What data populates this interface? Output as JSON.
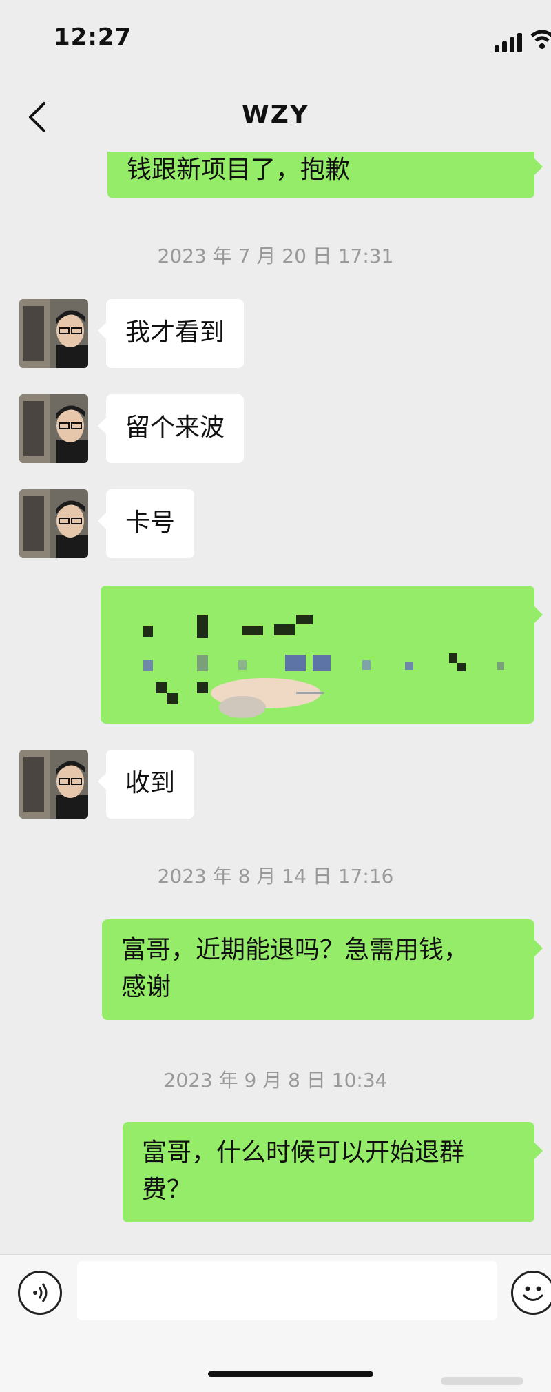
{
  "status_bar": {
    "time": "12:27",
    "icons": [
      "signal-icon",
      "wifi-icon"
    ]
  },
  "nav": {
    "title": "WZY",
    "back_icon": "chevron-left-icon"
  },
  "messages": [
    {
      "type": "text",
      "side": "out",
      "text": "钱跟新项目了，抱歉"
    },
    {
      "type": "timestamp",
      "text": "2023 年 7 月 20 日 17:31"
    },
    {
      "type": "text",
      "side": "in",
      "text": "我才看到"
    },
    {
      "type": "text",
      "side": "in",
      "text": "留个来波"
    },
    {
      "type": "text",
      "side": "in",
      "text": "卡号"
    },
    {
      "type": "redacted",
      "side": "out"
    },
    {
      "type": "text",
      "side": "in",
      "text": "收到"
    },
    {
      "type": "timestamp",
      "text": "2023 年 8 月 14 日 17:16"
    },
    {
      "type": "text",
      "side": "out",
      "lines": [
        "富哥，近期能退吗？急需用钱，",
        "感谢"
      ]
    },
    {
      "type": "timestamp",
      "text": "2023 年 9 月 8 日 10:34"
    },
    {
      "type": "text",
      "side": "out",
      "lines": [
        "富哥，什么时候可以开始退群",
        "费？"
      ]
    }
  ],
  "composer": {
    "voice_icon": "voice-icon",
    "emoji_icon": "emoji-icon",
    "input_value": ""
  },
  "colors": {
    "background": "#ededed",
    "outgoing_bubble": "#95ec69",
    "incoming_bubble": "#ffffff",
    "timestamp_text": "#9a9a9a"
  }
}
